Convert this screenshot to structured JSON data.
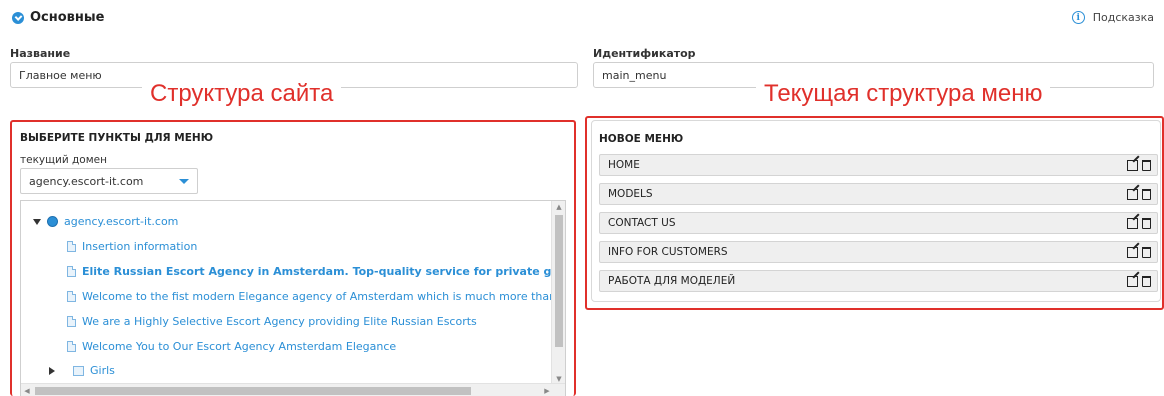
{
  "section": {
    "title": "Основные",
    "hint_label": "Подсказка"
  },
  "fields": {
    "name": {
      "label": "Название",
      "value": "Главное меню"
    },
    "id": {
      "label": "Идентификатор",
      "value": "main_menu"
    }
  },
  "annotations": {
    "left": "Структура сайта",
    "right": "Текущая структура меню"
  },
  "left_panel": {
    "title": "ВЫБЕРИТЕ ПУНКТЫ ДЛЯ МЕНЮ",
    "domain_label": "текущий домен",
    "domain_value": "agency.escort-it.com",
    "tree": [
      {
        "label": "agency.escort-it.com",
        "kind": "root"
      },
      {
        "label": "Insertion information",
        "kind": "page"
      },
      {
        "label": "Elite Russian Escort Agency in Amsterdam. Top-quality service for private gentlemen.",
        "kind": "page-bold"
      },
      {
        "label": "Welcome to the fist modern Elegance agency of Amsterdam which is much more than other e",
        "kind": "page"
      },
      {
        "label": "We are a Highly Selective Escort Agency providing Elite Russian Escorts",
        "kind": "page"
      },
      {
        "label": "Welcome You to Our Escort Agency Amsterdam Elegance",
        "kind": "page"
      },
      {
        "label": "Girls",
        "kind": "folder"
      }
    ]
  },
  "right_panel": {
    "title": "НОВОЕ МЕНЮ",
    "items": [
      {
        "label": "HOME"
      },
      {
        "label": "MODELS"
      },
      {
        "label": "CONTACT US"
      },
      {
        "label": "INFO FOR CUSTOMERS"
      },
      {
        "label": "РАБОТА ДЛЯ МОДЕЛЕЙ"
      }
    ]
  },
  "colors": {
    "accent": "#2b8fd6",
    "annotation": "#e0302b",
    "item_bg": "#efefef"
  },
  "icons": [
    "check-circle-icon",
    "info-icon",
    "globe-icon",
    "document-icon",
    "folder-icon",
    "edit-icon",
    "trash-icon",
    "dropdown-caret-icon",
    "expand-arrow-icon",
    "collapse-arrow-icon"
  ]
}
